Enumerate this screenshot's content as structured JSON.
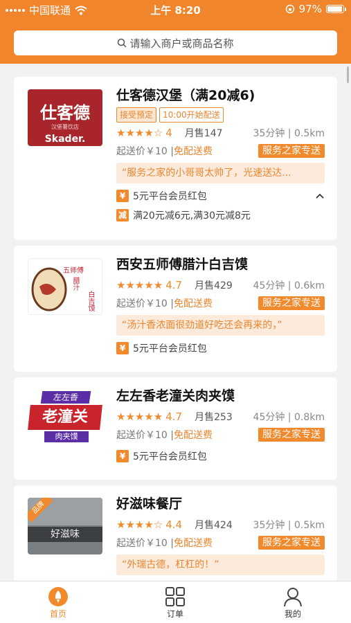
{
  "status_bar": {
    "carrier": "中国联通",
    "time": "上午 8:20",
    "battery": "97%"
  },
  "search": {
    "placeholder": "请输入商户或商品名称"
  },
  "restaurants": [
    {
      "name": "仕客德汉堡（满20减6)",
      "logo": {
        "brand": "仕客德",
        "sub": "汉堡薯饮店",
        "en": "Skader."
      },
      "tags": [
        "接受预定",
        "10:00开始配送"
      ],
      "stars": "★★★★☆",
      "rating": "4",
      "sales": "月售147",
      "delivery": "35分钟 | 0.5km",
      "min_price": "起送价￥10 |",
      "free_delivery": "免配送费",
      "service": "服务之家专送",
      "review": "“服务之家的小哥哥太帅了，光速送达...",
      "promos": [
        {
          "badge": "¥",
          "text": "5元平台会员红包"
        },
        {
          "badge": "减",
          "text": "满20元减6元,满30元减8元"
        }
      ],
      "collapse_icon": "chevron-up"
    },
    {
      "name": "西安五师傅腊汁白吉馍",
      "logo": {
        "brand": "五师傅",
        "sub": "腊汁",
        "en": "白吉馍"
      },
      "stars": "★★★★★",
      "rating": "4.7",
      "sales": "月售429",
      "delivery": "45分钟 | 0.6km",
      "min_price": "起送价￥10 |",
      "free_delivery": "免配送费",
      "service": "服务之家专送",
      "review": "“汤汁香浓面很劲道好吃还会再来的，”",
      "promos": [
        {
          "badge": "¥",
          "text": "5元平台会员红包"
        }
      ]
    },
    {
      "name": "左左香老潼关肉夹馍",
      "logo": {
        "brand": "左左香",
        "sub": "老潼关",
        "en": "肉夹馍"
      },
      "stars": "★★★★★",
      "rating": "4.7",
      "sales": "月售253",
      "delivery": "45分钟 | 0.8km",
      "min_price": "起送价￥10 |",
      "free_delivery": "免配送费",
      "service": "服务之家专送",
      "promos": [
        {
          "badge": "¥",
          "text": "5元平台会员红包"
        }
      ]
    },
    {
      "name": "好滋味餐厅",
      "logo": {
        "brand": "品牌",
        "sub": "好滋味"
      },
      "stars": "★★★★☆",
      "rating": "4.4",
      "sales": "月售424",
      "delivery": "35分钟 | 0.5km",
      "min_price": "起送价￥10 |",
      "free_delivery": "免配送费",
      "service": "服务之家专送",
      "review": "“外瑞古德，杠杠的！”"
    }
  ],
  "tabbar": {
    "tabs": [
      {
        "label": "首页",
        "icon": "home-rocket-icon",
        "active": true
      },
      {
        "label": "订单",
        "icon": "grid-icon",
        "active": false
      },
      {
        "label": "我的",
        "icon": "person-icon",
        "active": false
      }
    ]
  },
  "colors": {
    "accent": "#f0852b",
    "quote_bg": "#fdeadb"
  }
}
